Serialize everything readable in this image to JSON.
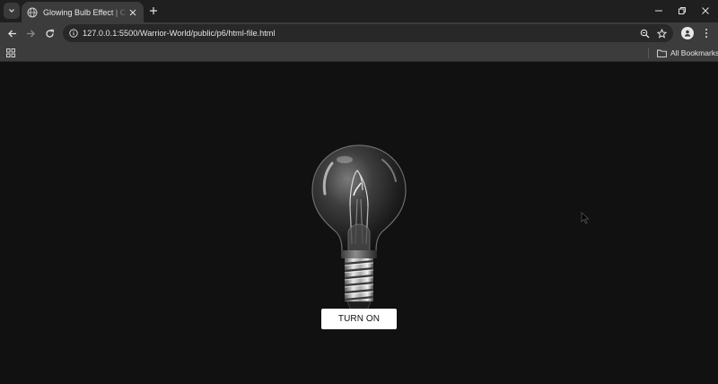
{
  "browser": {
    "tab": {
      "title": "Glowing Bulb Effect | CodingNepal"
    },
    "address_bar": {
      "url": "127.0.0.1:5500/Warrior-World/public/p6/html-file.html"
    },
    "bookmarks_bar": {
      "all_bookmarks_label": "All Bookmarks"
    },
    "icons": [
      "tab-search-icon",
      "globe-icon",
      "close-icon",
      "plus-icon",
      "minimize-icon",
      "restore-icon",
      "back-icon",
      "forward-icon",
      "reload-icon",
      "site-info-icon",
      "zoom-icon",
      "star-icon",
      "profile-icon",
      "more-menu-icon",
      "apps-grid-icon",
      "folder-icon"
    ]
  },
  "page": {
    "background_color": "#111111",
    "bulb": {
      "state": "off"
    },
    "toggle_button": {
      "label": "TURN ON"
    }
  }
}
